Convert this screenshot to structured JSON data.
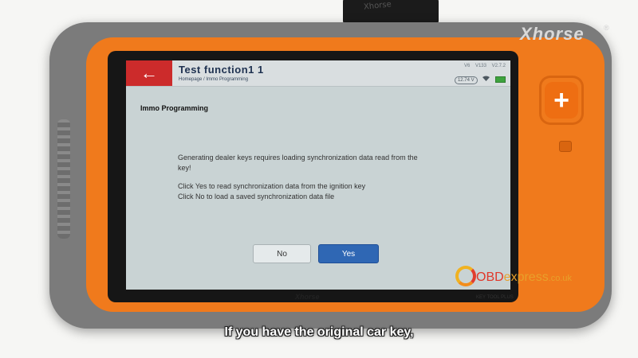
{
  "device": {
    "brand": "Xhorse",
    "registered": "®",
    "bottom_brand": "Xhorse",
    "model": "KEY TOOL PLUS",
    "cable_text": "Xhorse",
    "dpad_symbol": "+"
  },
  "app": {
    "back_icon": "←",
    "title": "Test function1 1",
    "breadcrumb": "Homepage / Immo Programming",
    "status": {
      "left": "V6",
      "mid": "V133",
      "version": "V2.7.2",
      "voltage": "12.74 V",
      "wifi_icon": "wifi-icon",
      "battery_icon": "battery-icon"
    }
  },
  "dialog": {
    "heading": "Immo Programming",
    "line1": "Generating dealer keys requires loading synchronization data read from the",
    "line2": "key!",
    "line3": "Click Yes to read synchronization data from the ignition key",
    "line4": "Click No to load a saved synchronization data file",
    "no_label": "No",
    "yes_label": "Yes"
  },
  "watermark": {
    "obd": "OBD",
    "express": "express",
    "tld": ".co.uk"
  },
  "subtitle": "If you have the original car key,",
  "colors": {
    "accent_orange": "#f07a1c",
    "back_red": "#cc2b2b",
    "yes_blue": "#2f67b4"
  }
}
